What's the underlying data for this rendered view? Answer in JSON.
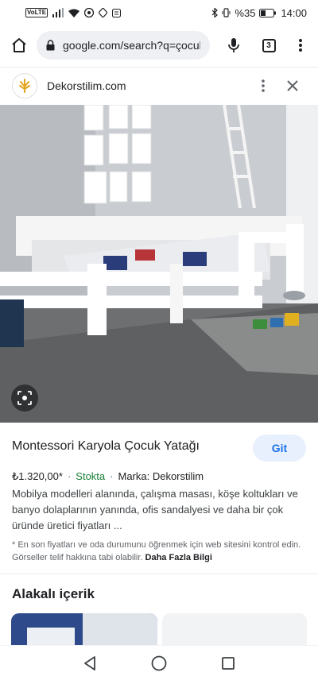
{
  "status_bar": {
    "volte": "VoLTE",
    "battery_text": "%35",
    "time": "14:00"
  },
  "browser": {
    "url": "google.com/search?q=çocuk+y",
    "tab_count": "3"
  },
  "site": {
    "name": "Dekorstilim.com"
  },
  "product": {
    "title": "Montessori Karyola Çocuk Yatağı",
    "go_label": "Git",
    "price": "₺1.320,00*",
    "stock": "Stokta",
    "brand": "Marka: Dekorstilim",
    "description": "Mobilya modelleri alanında, çalışma masası, köşe koltukları ve banyo dolaplarının yanında, ofis sandalyesi ve daha bir çok üründe üretici fiyatları ...",
    "disclaimer": "* En son fiyatları ve oda durumunu öğrenmek için web sitesini kontrol edin. Görseller telif hakkına tabi olabilir.",
    "more_info": "Daha Fazla Bilgi"
  },
  "related": {
    "title": "Alakalı içerik"
  },
  "colors": {
    "accent": "#1a73e8",
    "stock_green": "#188038",
    "button_bg": "#e8f0fe"
  }
}
